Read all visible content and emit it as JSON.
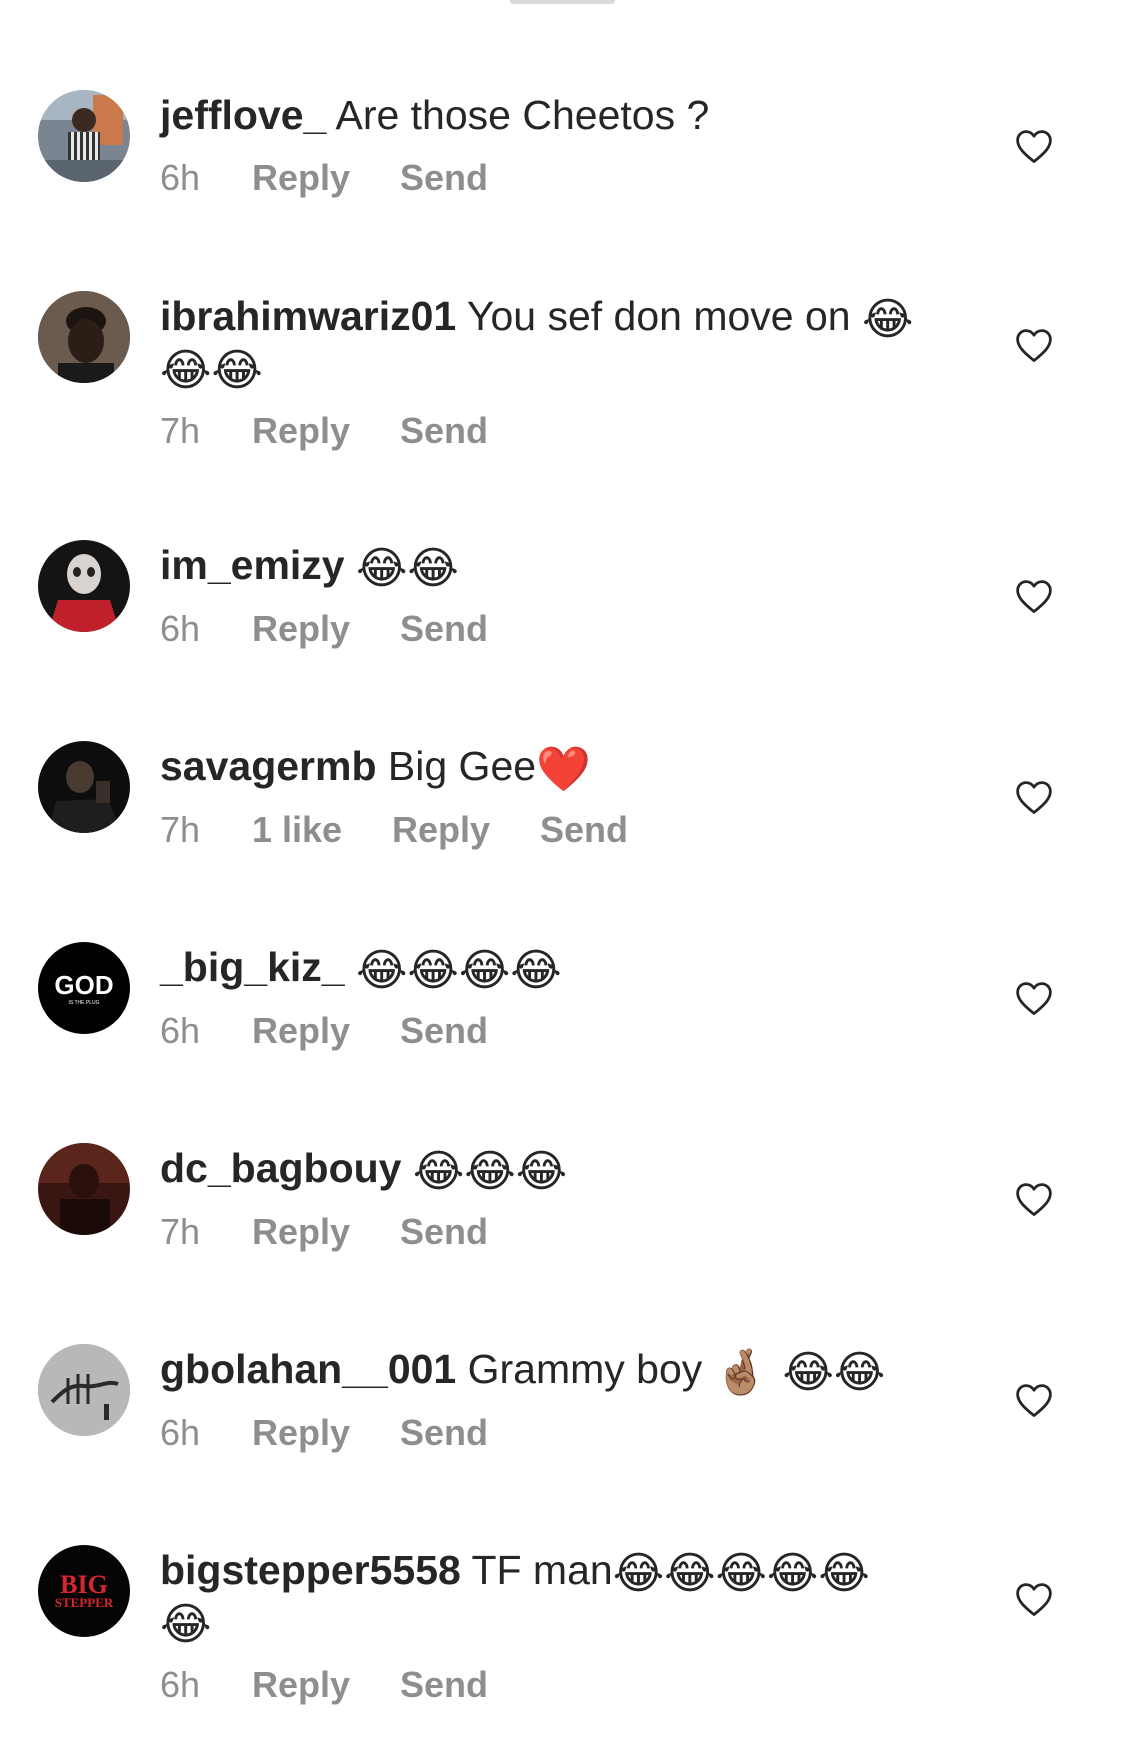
{
  "comments": [
    {
      "username": "jefflove_",
      "text": " Are those Cheetos ?",
      "emoji": "",
      "emoji2": "",
      "time": "6h",
      "likes": "",
      "reply": "Reply",
      "send": "Send"
    },
    {
      "username": "ibrahimwariz01",
      "text": " You sef don move on ",
      "emoji": "😂",
      "emoji2": "😂😂",
      "time": "7h",
      "likes": "",
      "reply": "Reply",
      "send": "Send"
    },
    {
      "username": "im_emizy",
      "text": " ",
      "emoji": "😂😂",
      "emoji2": "",
      "time": "6h",
      "likes": "",
      "reply": "Reply",
      "send": "Send"
    },
    {
      "username": "savagermb",
      "text": " Big Gee",
      "emoji": "❤️",
      "emoji2": "",
      "time": "7h",
      "likes": "1 like",
      "reply": "Reply",
      "send": "Send"
    },
    {
      "username": "_big_kiz_",
      "text": " ",
      "emoji": "😂😂😂😂",
      "emoji2": "",
      "time": "6h",
      "likes": "",
      "reply": "Reply",
      "send": "Send"
    },
    {
      "username": "dc_bagbouy",
      "text": " ",
      "emoji": "😂😂😂",
      "emoji2": "",
      "time": "7h",
      "likes": "",
      "reply": "Reply",
      "send": "Send"
    },
    {
      "username": "gbolahan__001",
      "text": " Grammy boy ",
      "emoji": "🤞🏽 😂😂",
      "emoji2": "",
      "time": "6h",
      "likes": "",
      "reply": "Reply",
      "send": "Send"
    },
    {
      "username": "bigstepper5558",
      "text": " TF man",
      "emoji": "😂😂😂😂😂",
      "emoji2": "😂",
      "time": "6h",
      "likes": "",
      "reply": "Reply",
      "send": "Send"
    }
  ],
  "avatars": {
    "god_logo": "GOD",
    "god_sub": "IS THE PLUG",
    "big_logo": "BIG",
    "big_sub": "STEPPER"
  },
  "colors": {
    "text": "#262626",
    "meta": "#8e8e8e",
    "background": "#ffffff"
  }
}
